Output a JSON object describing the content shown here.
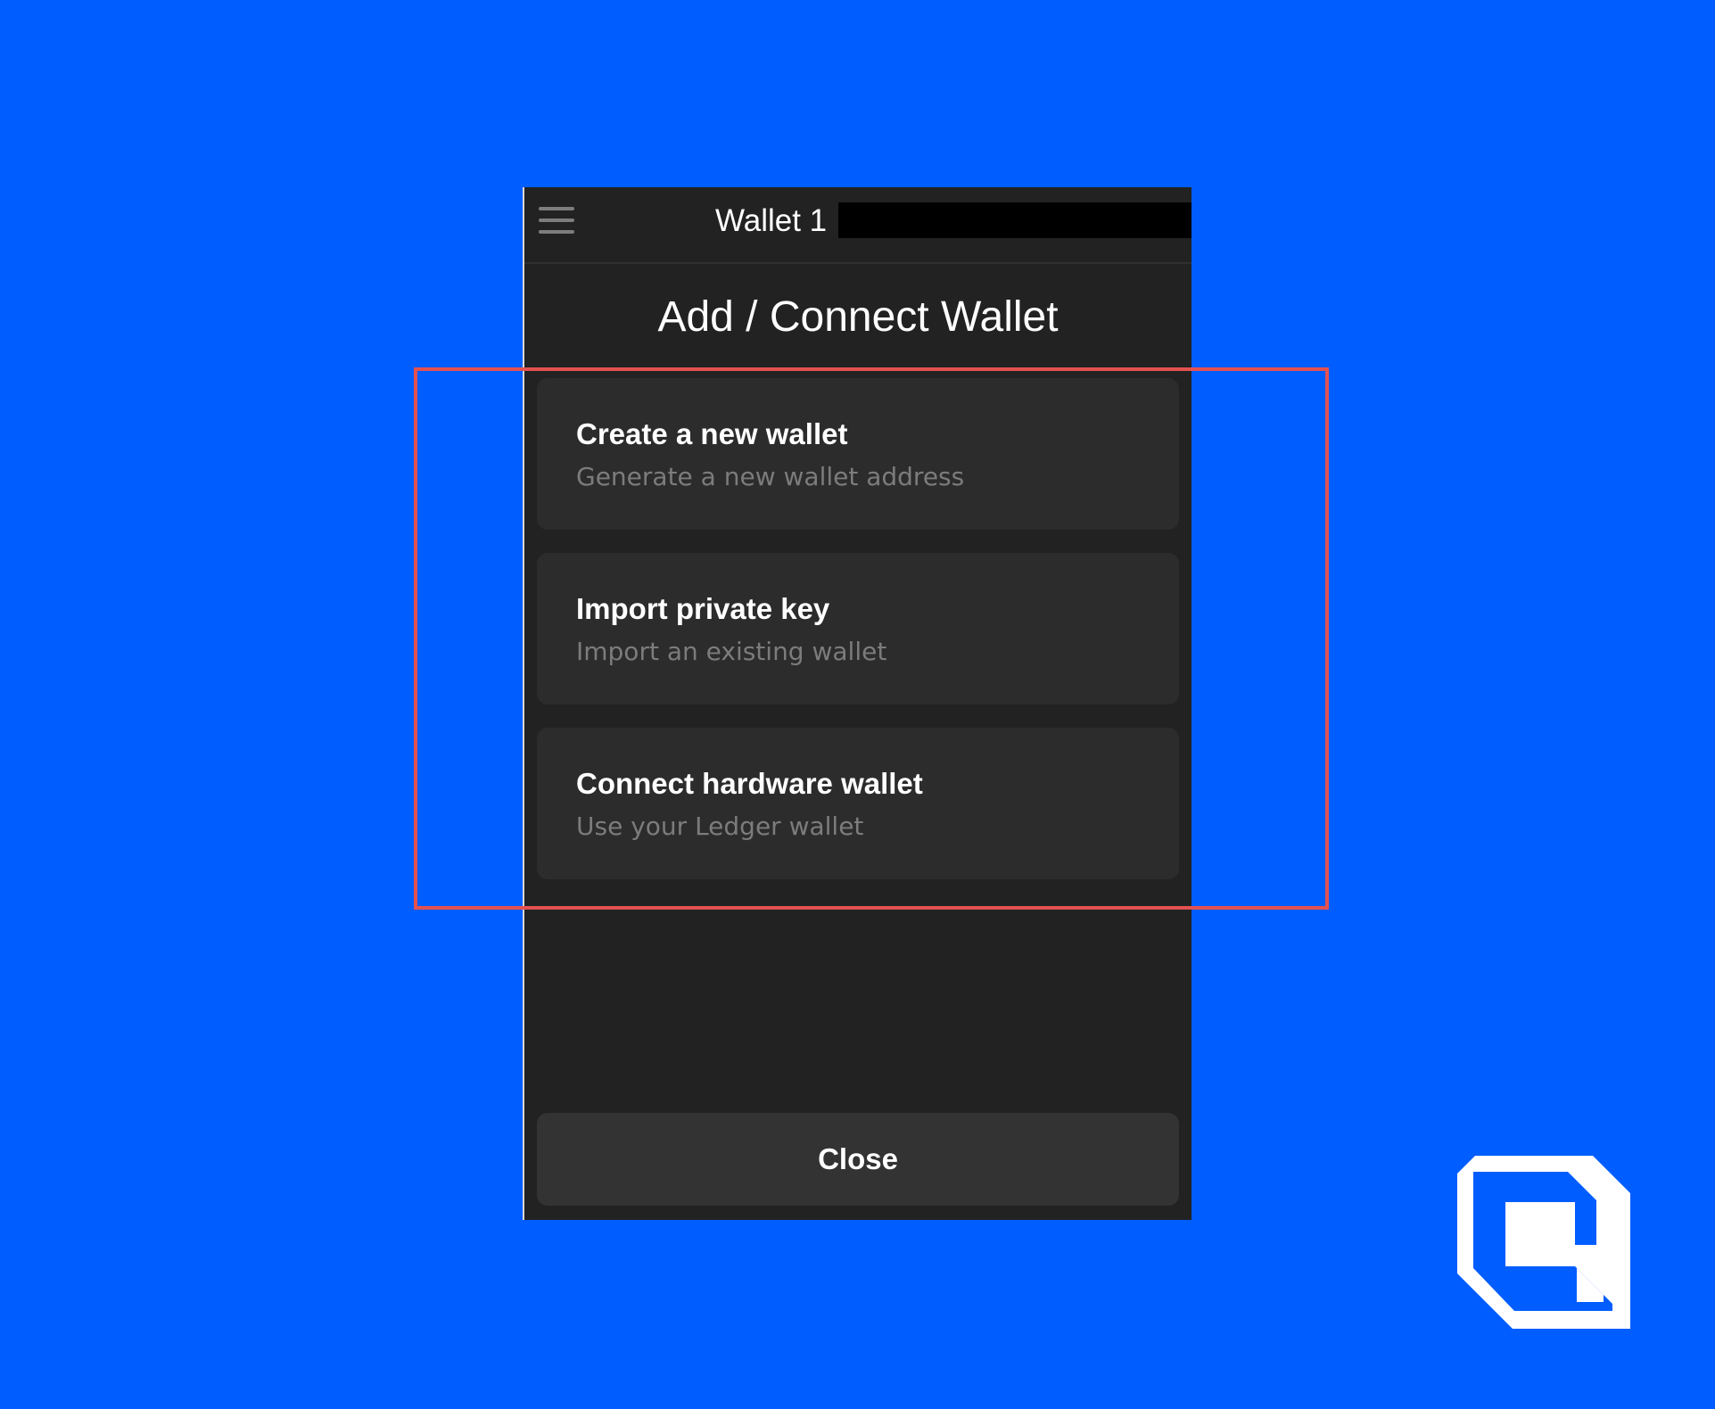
{
  "header": {
    "wallet_name": "Wallet 1",
    "menu_icon": "hamburger-menu-icon"
  },
  "page": {
    "title": "Add / Connect Wallet"
  },
  "options": [
    {
      "title": "Create a new wallet",
      "subtitle": "Generate a new wallet address"
    },
    {
      "title": "Import private key",
      "subtitle": "Import an existing wallet"
    },
    {
      "title": "Connect hardware wallet",
      "subtitle": "Use your Ledger wallet"
    }
  ],
  "footer": {
    "close_label": "Close"
  },
  "colors": {
    "background": "#005dff",
    "panel": "#222222",
    "card": "#2c2c2c",
    "highlight": "#e35151"
  },
  "brand": {
    "logo_icon": "brand-logo-icon"
  }
}
